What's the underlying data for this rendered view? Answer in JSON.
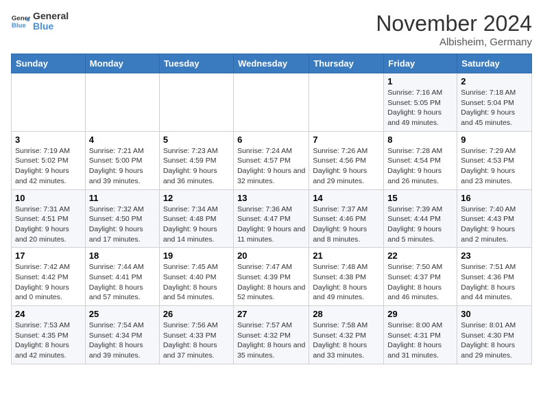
{
  "header": {
    "logo_line1": "General",
    "logo_line2": "Blue",
    "month": "November 2024",
    "location": "Albisheim, Germany"
  },
  "weekdays": [
    "Sunday",
    "Monday",
    "Tuesday",
    "Wednesday",
    "Thursday",
    "Friday",
    "Saturday"
  ],
  "weeks": [
    [
      {
        "day": "",
        "info": ""
      },
      {
        "day": "",
        "info": ""
      },
      {
        "day": "",
        "info": ""
      },
      {
        "day": "",
        "info": ""
      },
      {
        "day": "",
        "info": ""
      },
      {
        "day": "1",
        "info": "Sunrise: 7:16 AM\nSunset: 5:05 PM\nDaylight: 9 hours and 49 minutes."
      },
      {
        "day": "2",
        "info": "Sunrise: 7:18 AM\nSunset: 5:04 PM\nDaylight: 9 hours and 45 minutes."
      }
    ],
    [
      {
        "day": "3",
        "info": "Sunrise: 7:19 AM\nSunset: 5:02 PM\nDaylight: 9 hours and 42 minutes."
      },
      {
        "day": "4",
        "info": "Sunrise: 7:21 AM\nSunset: 5:00 PM\nDaylight: 9 hours and 39 minutes."
      },
      {
        "day": "5",
        "info": "Sunrise: 7:23 AM\nSunset: 4:59 PM\nDaylight: 9 hours and 36 minutes."
      },
      {
        "day": "6",
        "info": "Sunrise: 7:24 AM\nSunset: 4:57 PM\nDaylight: 9 hours and 32 minutes."
      },
      {
        "day": "7",
        "info": "Sunrise: 7:26 AM\nSunset: 4:56 PM\nDaylight: 9 hours and 29 minutes."
      },
      {
        "day": "8",
        "info": "Sunrise: 7:28 AM\nSunset: 4:54 PM\nDaylight: 9 hours and 26 minutes."
      },
      {
        "day": "9",
        "info": "Sunrise: 7:29 AM\nSunset: 4:53 PM\nDaylight: 9 hours and 23 minutes."
      }
    ],
    [
      {
        "day": "10",
        "info": "Sunrise: 7:31 AM\nSunset: 4:51 PM\nDaylight: 9 hours and 20 minutes."
      },
      {
        "day": "11",
        "info": "Sunrise: 7:32 AM\nSunset: 4:50 PM\nDaylight: 9 hours and 17 minutes."
      },
      {
        "day": "12",
        "info": "Sunrise: 7:34 AM\nSunset: 4:48 PM\nDaylight: 9 hours and 14 minutes."
      },
      {
        "day": "13",
        "info": "Sunrise: 7:36 AM\nSunset: 4:47 PM\nDaylight: 9 hours and 11 minutes."
      },
      {
        "day": "14",
        "info": "Sunrise: 7:37 AM\nSunset: 4:46 PM\nDaylight: 9 hours and 8 minutes."
      },
      {
        "day": "15",
        "info": "Sunrise: 7:39 AM\nSunset: 4:44 PM\nDaylight: 9 hours and 5 minutes."
      },
      {
        "day": "16",
        "info": "Sunrise: 7:40 AM\nSunset: 4:43 PM\nDaylight: 9 hours and 2 minutes."
      }
    ],
    [
      {
        "day": "17",
        "info": "Sunrise: 7:42 AM\nSunset: 4:42 PM\nDaylight: 9 hours and 0 minutes."
      },
      {
        "day": "18",
        "info": "Sunrise: 7:44 AM\nSunset: 4:41 PM\nDaylight: 8 hours and 57 minutes."
      },
      {
        "day": "19",
        "info": "Sunrise: 7:45 AM\nSunset: 4:40 PM\nDaylight: 8 hours and 54 minutes."
      },
      {
        "day": "20",
        "info": "Sunrise: 7:47 AM\nSunset: 4:39 PM\nDaylight: 8 hours and 52 minutes."
      },
      {
        "day": "21",
        "info": "Sunrise: 7:48 AM\nSunset: 4:38 PM\nDaylight: 8 hours and 49 minutes."
      },
      {
        "day": "22",
        "info": "Sunrise: 7:50 AM\nSunset: 4:37 PM\nDaylight: 8 hours and 46 minutes."
      },
      {
        "day": "23",
        "info": "Sunrise: 7:51 AM\nSunset: 4:36 PM\nDaylight: 8 hours and 44 minutes."
      }
    ],
    [
      {
        "day": "24",
        "info": "Sunrise: 7:53 AM\nSunset: 4:35 PM\nDaylight: 8 hours and 42 minutes."
      },
      {
        "day": "25",
        "info": "Sunrise: 7:54 AM\nSunset: 4:34 PM\nDaylight: 8 hours and 39 minutes."
      },
      {
        "day": "26",
        "info": "Sunrise: 7:56 AM\nSunset: 4:33 PM\nDaylight: 8 hours and 37 minutes."
      },
      {
        "day": "27",
        "info": "Sunrise: 7:57 AM\nSunset: 4:32 PM\nDaylight: 8 hours and 35 minutes."
      },
      {
        "day": "28",
        "info": "Sunrise: 7:58 AM\nSunset: 4:32 PM\nDaylight: 8 hours and 33 minutes."
      },
      {
        "day": "29",
        "info": "Sunrise: 8:00 AM\nSunset: 4:31 PM\nDaylight: 8 hours and 31 minutes."
      },
      {
        "day": "30",
        "info": "Sunrise: 8:01 AM\nSunset: 4:30 PM\nDaylight: 8 hours and 29 minutes."
      }
    ]
  ]
}
